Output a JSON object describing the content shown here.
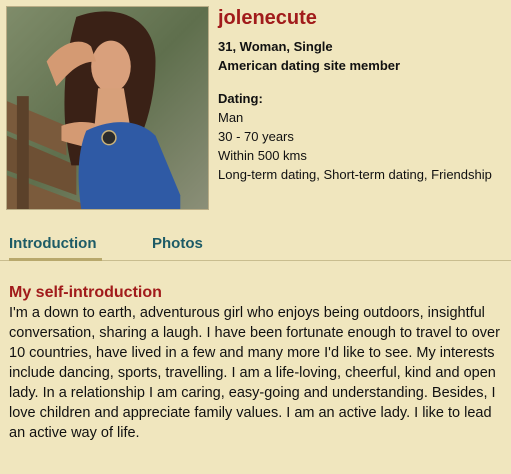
{
  "profile": {
    "username": "jolenecute",
    "summary": "31, Woman, Single",
    "membership": "American dating site member",
    "dating_heading": "Dating:",
    "seeking_gender": "Man",
    "age_range": "30 - 70 years",
    "distance": "Within 500 kms",
    "relationship_types": "Long-term dating, Short-term dating, Friendship"
  },
  "tabs": [
    {
      "label": "Introduction",
      "active": true
    },
    {
      "label": "Photos",
      "active": false
    }
  ],
  "intro": {
    "title": "My self-introduction",
    "text": "I'm a down to earth, adventurous girl who enjoys being outdoors, insightful conversation, sharing a laugh. I have been fortunate enough to travel to over 10 countries, have lived in a few and many more I'd like to see. My interests include dancing, sports, travelling. I am a life-loving, cheerful, kind and open lady. In a relationship I am caring, easy-going and understanding. Besides, I love children and appreciate family values. I am an active lady. I like to lead an active way of life."
  },
  "colors": {
    "background": "#f0e6be",
    "username": "#a11b1b",
    "tab_text": "#1d5b66",
    "tab_underline": "#b8a86c"
  }
}
